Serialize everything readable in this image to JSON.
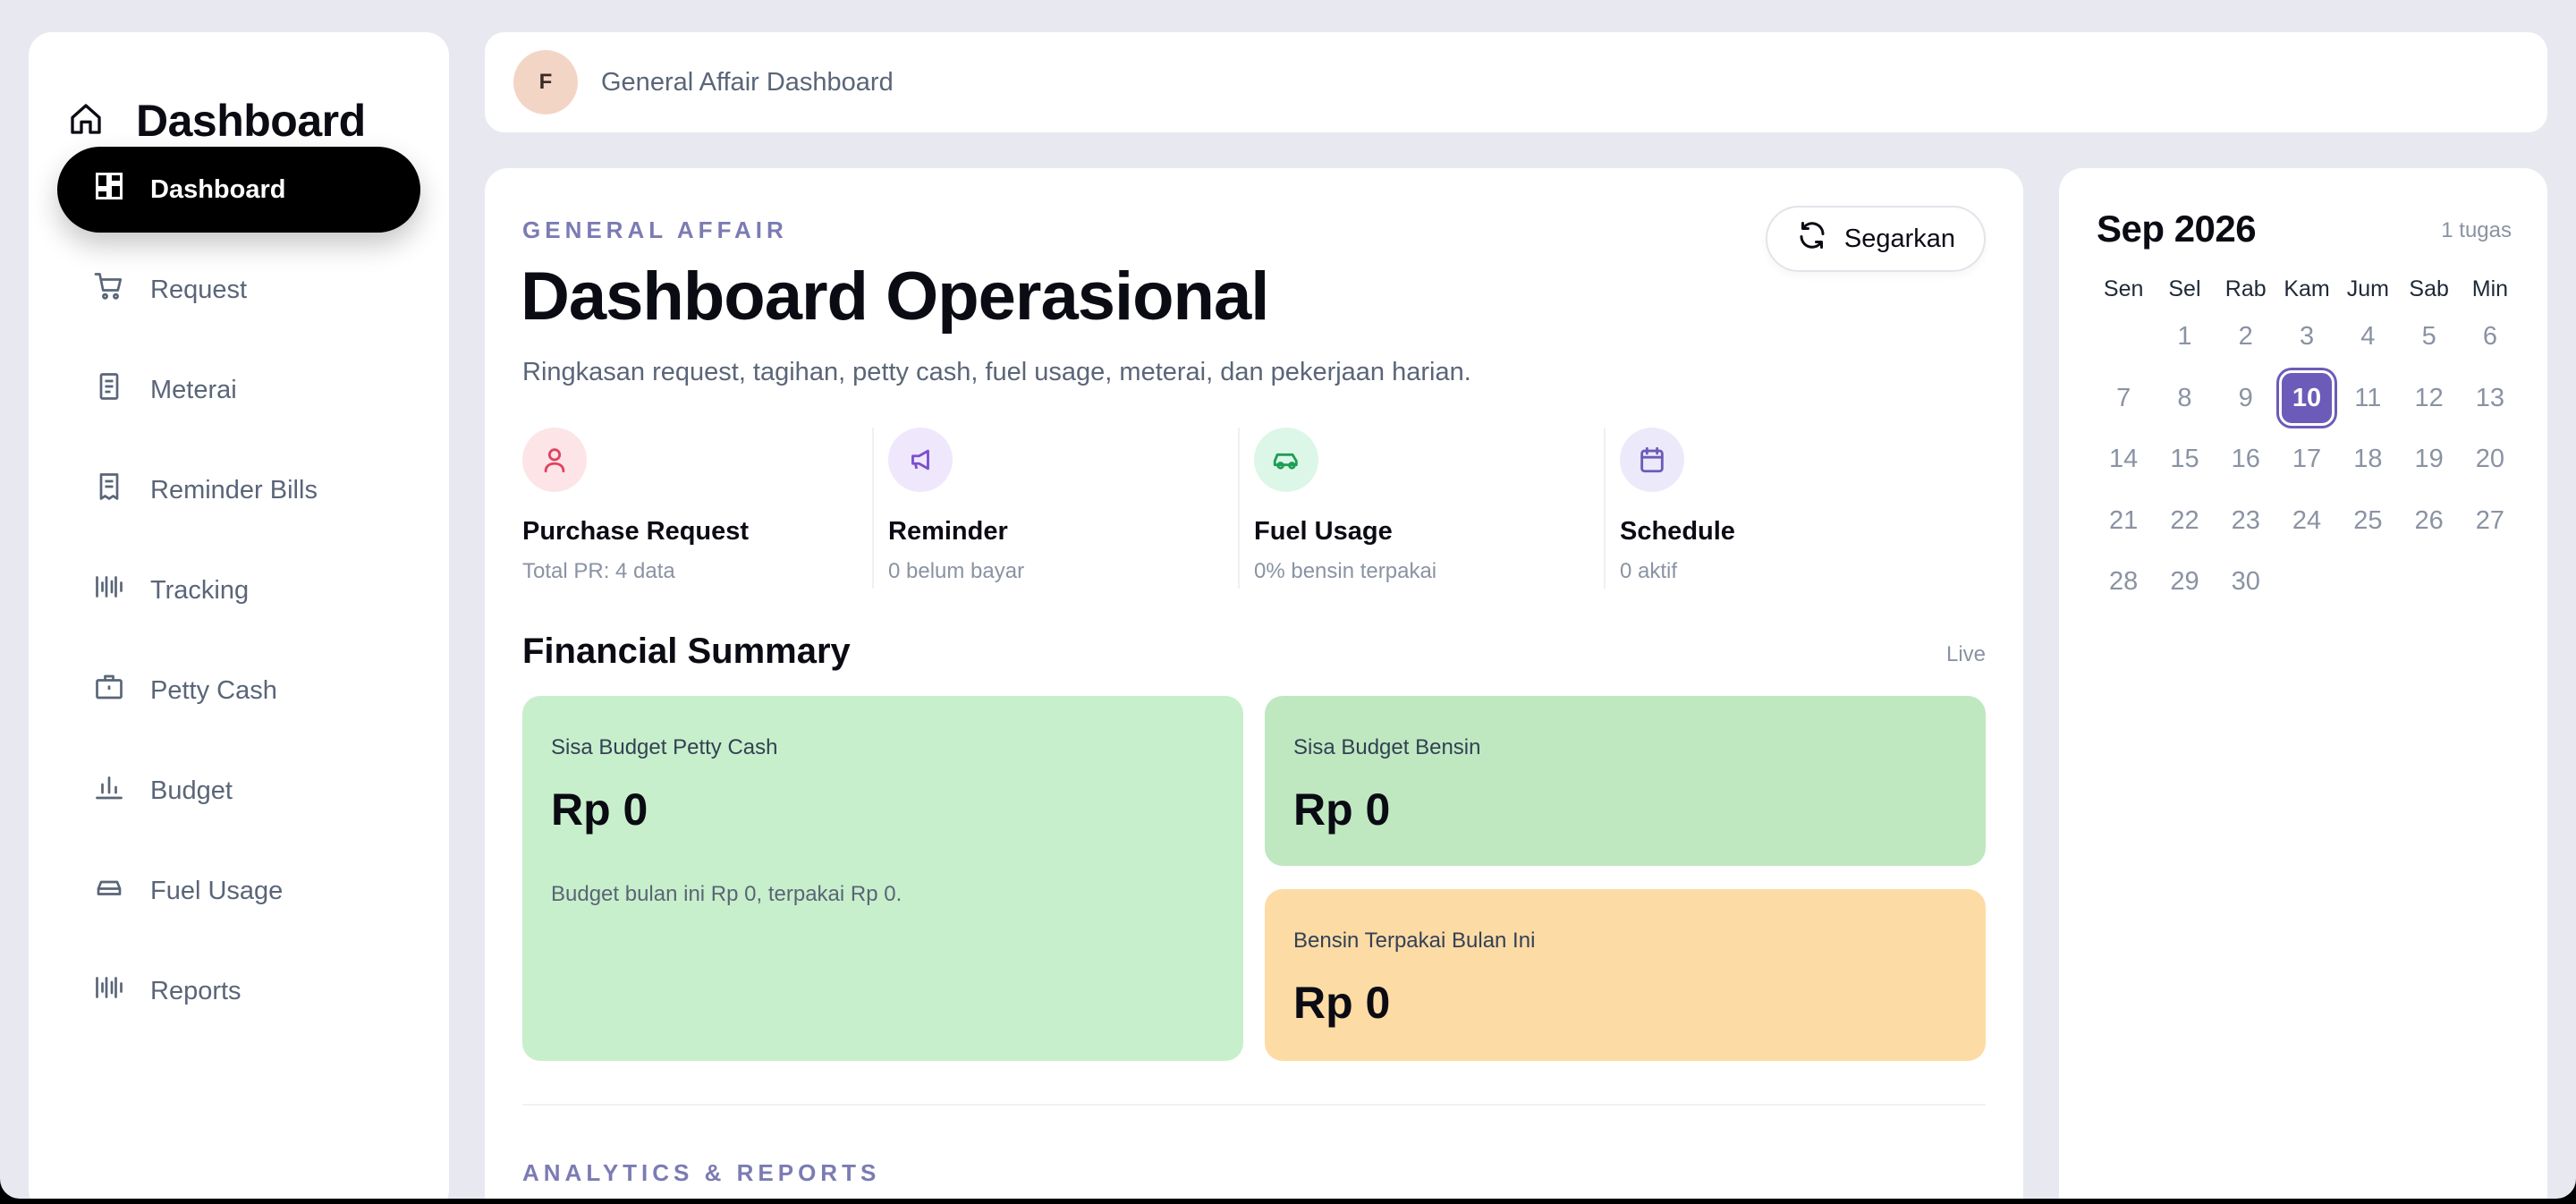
{
  "sidebar": {
    "brand": "Dashboard",
    "items": [
      {
        "label": "Dashboard",
        "icon": "dashboard-icon"
      },
      {
        "label": "Request",
        "icon": "cart-icon"
      },
      {
        "label": "Meterai",
        "icon": "document-icon"
      },
      {
        "label": "Reminder Bills",
        "icon": "receipt-icon"
      },
      {
        "label": "Tracking",
        "icon": "barcode-icon"
      },
      {
        "label": "Petty Cash",
        "icon": "briefcase-icon"
      },
      {
        "label": "Budget",
        "icon": "bar-chart-icon"
      },
      {
        "label": "Fuel Usage",
        "icon": "car-icon"
      },
      {
        "label": "Reports",
        "icon": "barcode-icon"
      }
    ]
  },
  "topbar": {
    "avatar": "F",
    "title": "General Affair Dashboard"
  },
  "main": {
    "eyebrow": "GENERAL AFFAIR",
    "title": "Dashboard Operasional",
    "subtitle": "Ringkasan request, tagihan, petty cash, fuel usage, meterai, dan pekerjaan harian.",
    "refresh_label": "Segarkan",
    "stats": [
      {
        "title": "Purchase Request",
        "sub": "Total PR: 4 data",
        "icon": "user-icon",
        "bg": "#fde4e7",
        "fg": "#e0435f"
      },
      {
        "title": "Reminder",
        "sub": "0 belum bayar",
        "icon": "megaphone-icon",
        "bg": "#efe7fb",
        "fg": "#7b4fcf"
      },
      {
        "title": "Fuel Usage",
        "sub": "0% bensin terpakai",
        "icon": "car-icon",
        "bg": "#dcf7e7",
        "fg": "#1f9e55"
      },
      {
        "title": "Schedule",
        "sub": "0 aktif",
        "icon": "calendar-icon",
        "bg": "#ece9fa",
        "fg": "#6c5bb8"
      }
    ],
    "financial": {
      "title": "Financial Summary",
      "status": "Live",
      "cards": [
        {
          "label": "Sisa Budget Petty Cash",
          "value": "Rp 0",
          "note": "Budget bulan ini Rp 0, terpakai Rp 0.",
          "color": "#c8efcb"
        },
        {
          "label": "Sisa Budget Bensin",
          "value": "Rp 0",
          "color": "#bfe8c0"
        },
        {
          "label": "Bensin Terpakai Bulan Ini",
          "value": "Rp 0",
          "color": "#fddba5"
        }
      ]
    },
    "analytics_eyebrow": "ANALYTICS & REPORTS"
  },
  "calendar": {
    "month": "Sep 2026",
    "task_count": "1 tugas",
    "weekdays": [
      "Sen",
      "Sel",
      "Rab",
      "Kam",
      "Jum",
      "Sab",
      "Min"
    ],
    "leading_blanks": 1,
    "days": [
      "1",
      "2",
      "3",
      "4",
      "5",
      "6",
      "7",
      "8",
      "9",
      "10",
      "11",
      "12",
      "13",
      "14",
      "15",
      "16",
      "17",
      "18",
      "19",
      "20",
      "21",
      "22",
      "23",
      "24",
      "25",
      "26",
      "27",
      "28",
      "29",
      "30"
    ],
    "today": "10"
  }
}
